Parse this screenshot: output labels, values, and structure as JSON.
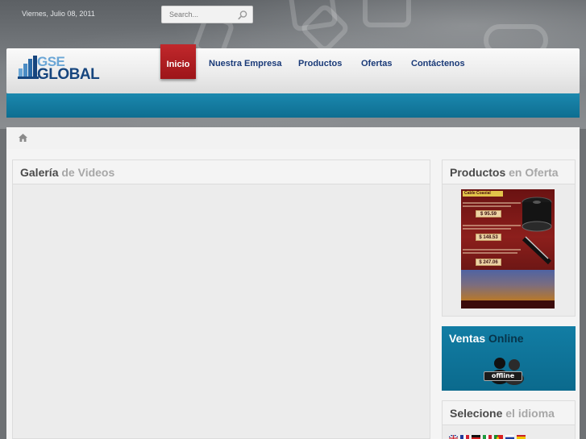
{
  "topbar": {
    "date": "Viernes, Julio 08, 2011",
    "search_placeholder": "Search..."
  },
  "brand": {
    "line1": "GSE",
    "line2": "GLOBAL",
    "colors": {
      "light_blue": "#6aa6d6",
      "dark_blue": "#16457e"
    }
  },
  "nav": {
    "items": [
      {
        "label": "Inicio",
        "active": true
      },
      {
        "label": "Nuestra Empresa"
      },
      {
        "label": "Productos"
      },
      {
        "label": "Ofertas"
      },
      {
        "label": "Contáctenos"
      }
    ],
    "active_color": "#b31f23"
  },
  "accent_blue": "#137ea5",
  "main": {
    "title_strong": "Galería",
    "title_light": "de Videos"
  },
  "sidebar": {
    "offers": {
      "title_strong": "Productos",
      "title_light": "en Oferta",
      "image": {
        "heading": "Cable Coaxial",
        "prices": [
          "$ 95.59",
          "$ 148.53",
          "$ 247.06"
        ]
      }
    },
    "sales": {
      "title_strong": "Ventas",
      "title_light": "Online",
      "status": "offline"
    },
    "language": {
      "title_strong": "Selecione",
      "title_light": "el idioma",
      "flags": [
        "uk-flag-icon",
        "france-flag-icon",
        "germany-flag-icon",
        "italy-flag-icon",
        "portugal-flag-icon",
        "russia-flag-icon",
        "spain-flag-icon"
      ]
    }
  }
}
